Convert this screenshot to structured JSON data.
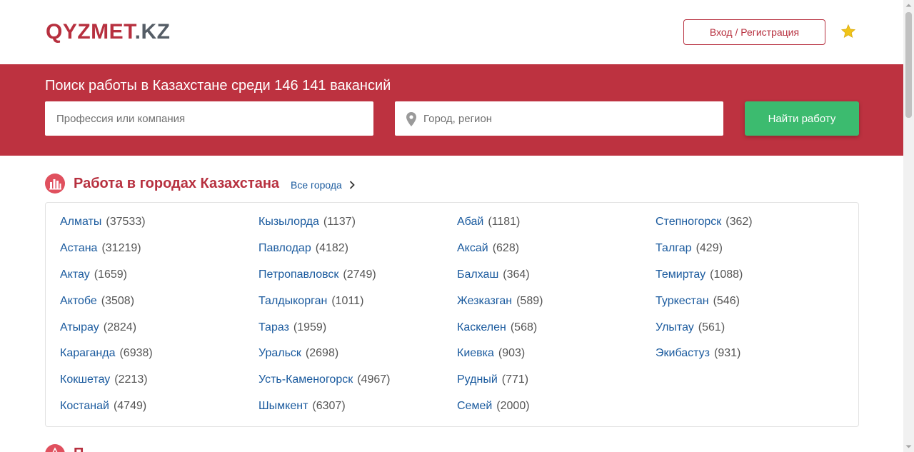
{
  "header": {
    "logo_part1": "QYZMET",
    "logo_part2": ".KZ",
    "login_label": "Вход / Регистрация"
  },
  "search": {
    "title": "Поиск работы в Казахстане среди 146 141 вакансий",
    "profession_placeholder": "Профессия или компания",
    "city_placeholder": "Город, регион",
    "button_label": "Найти работу"
  },
  "section": {
    "title": "Работа в городах Казахстана",
    "all_cities_label": "Все города"
  },
  "cities": {
    "col1": [
      {
        "name": "Алматы",
        "count": "(37533)"
      },
      {
        "name": "Астана",
        "count": "(31219)"
      },
      {
        "name": "Актау",
        "count": "(1659)"
      },
      {
        "name": "Актобе",
        "count": "(3508)"
      },
      {
        "name": "Атырау",
        "count": "(2824)"
      },
      {
        "name": "Караганда",
        "count": "(6938)"
      },
      {
        "name": "Кокшетау",
        "count": "(2213)"
      },
      {
        "name": "Костанай",
        "count": "(4749)"
      }
    ],
    "col2": [
      {
        "name": "Кызылорда",
        "count": "(1137)"
      },
      {
        "name": "Павлодар",
        "count": "(4182)"
      },
      {
        "name": "Петропавловск",
        "count": "(2749)"
      },
      {
        "name": "Талдыкорган",
        "count": "(1011)"
      },
      {
        "name": "Тараз",
        "count": "(1959)"
      },
      {
        "name": "Уральск",
        "count": "(2698)"
      },
      {
        "name": "Усть-Каменогорск",
        "count": "(4967)"
      },
      {
        "name": "Шымкент",
        "count": "(6307)"
      }
    ],
    "col3": [
      {
        "name": "Абай",
        "count": "(1181)"
      },
      {
        "name": "Аксай",
        "count": "(628)"
      },
      {
        "name": "Балхаш",
        "count": "(364)"
      },
      {
        "name": "Жезказган",
        "count": "(589)"
      },
      {
        "name": "Каскелен",
        "count": "(568)"
      },
      {
        "name": "Киевка",
        "count": "(903)"
      },
      {
        "name": "Рудный",
        "count": "(771)"
      },
      {
        "name": "Семей",
        "count": "(2000)"
      }
    ],
    "col4": [
      {
        "name": "Степногорск",
        "count": "(362)"
      },
      {
        "name": "Талгар",
        "count": "(429)"
      },
      {
        "name": "Темиртау",
        "count": "(1088)"
      },
      {
        "name": "Туркестан",
        "count": "(546)"
      },
      {
        "name": "Улытау",
        "count": "(561)"
      },
      {
        "name": "Экибастуз",
        "count": "(931)"
      }
    ]
  },
  "next_section": {
    "title": "П"
  },
  "colors": {
    "brand_red": "#bd3240",
    "link_blue": "#1a5a9e",
    "button_green": "#3cbb6f",
    "star_gold": "#f0c419"
  },
  "icons": {
    "favorite": "star-icon",
    "location": "pin-icon",
    "section": "city-chart-icon",
    "all_cities": "chevron-right-icon"
  }
}
